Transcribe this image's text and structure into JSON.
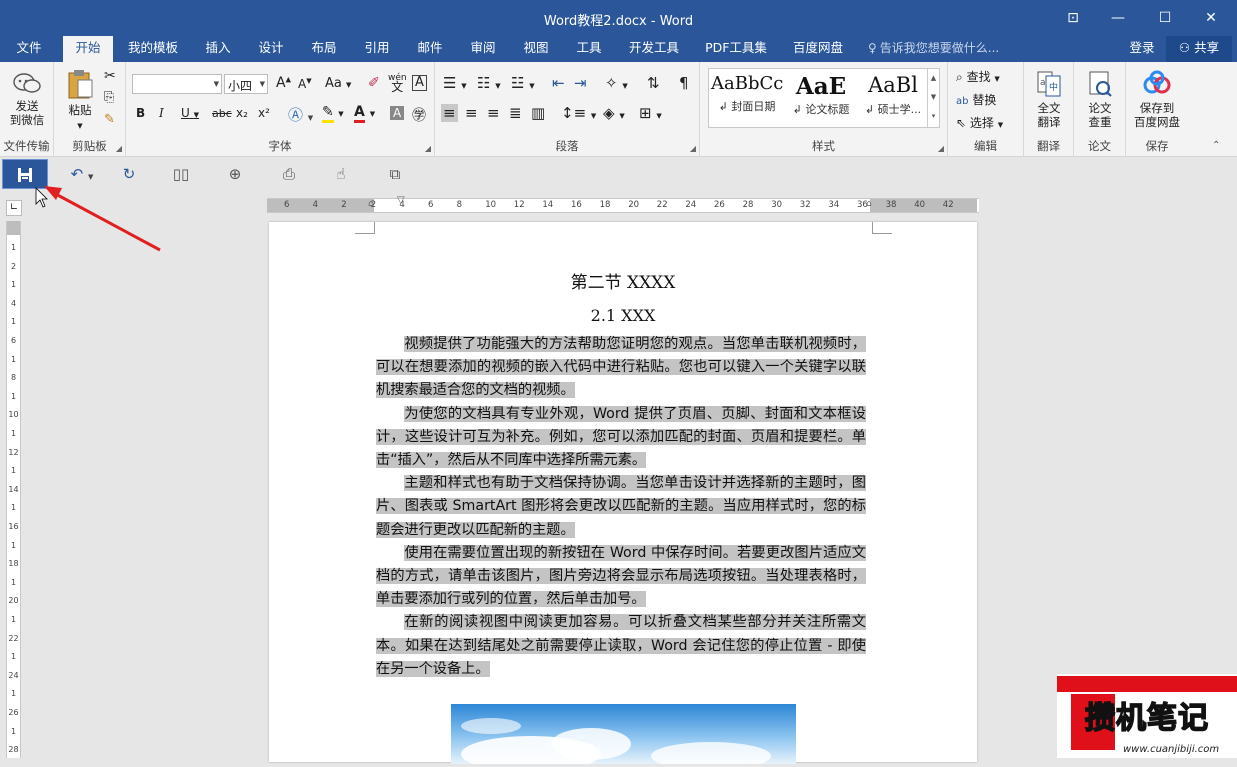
{
  "window": {
    "title": "Word教程2.docx - Word",
    "ribbon_options_glyph": "⊡",
    "minimize_glyph": "—",
    "restore_glyph": "☐",
    "close_glyph": "✕"
  },
  "tabs": [
    {
      "label": "文件"
    },
    {
      "label": "开始"
    },
    {
      "label": "我的模板"
    },
    {
      "label": "插入"
    },
    {
      "label": "设计"
    },
    {
      "label": "布局"
    },
    {
      "label": "引用"
    },
    {
      "label": "邮件"
    },
    {
      "label": "审阅"
    },
    {
      "label": "视图"
    },
    {
      "label": "工具"
    },
    {
      "label": "开发工具"
    },
    {
      "label": "PDF工具集"
    },
    {
      "label": "百度网盘"
    }
  ],
  "tellme": "告诉我您想要做什么...",
  "login": "登录",
  "share": "共享",
  "ribbon": {
    "file_transfer": {
      "send_line1": "发送",
      "send_line2": "到微信",
      "label": "文件传输"
    },
    "clipboard": {
      "paste": "粘贴",
      "label": "剪贴板"
    },
    "font": {
      "font_name": "",
      "font_size": "小四",
      "label": "字体",
      "bold": "B",
      "italic": "I",
      "underline": "U",
      "strike": "abc",
      "sub": "x₂",
      "sup": "x²",
      "grow": "A",
      "shrink": "A",
      "case": "Aa",
      "phonetic": "wén",
      "char_border": "A"
    },
    "paragraph": {
      "label": "段落"
    },
    "styles": {
      "label": "样式",
      "items": [
        {
          "sample": "AaBbCc",
          "name": "↲ 封面日期"
        },
        {
          "sample": "AaE",
          "name": "↲ 论文标题"
        },
        {
          "sample": "AaBl",
          "name": "↲ 硕士学..."
        }
      ]
    },
    "editing": {
      "find": "查找",
      "replace": "替换",
      "select": "选择",
      "label": "编辑"
    },
    "translate": {
      "btn_line1": "全文",
      "btn_line2": "翻译",
      "label": "翻译"
    },
    "thesis": {
      "btn_line1": "论文",
      "btn_line2": "查重",
      "label": "论文"
    },
    "save": {
      "btn_line1": "保存到",
      "btn_line2": "百度网盘",
      "label": "保存"
    }
  },
  "document": {
    "heading1": "第二节 XXXX",
    "heading2": "2.1 XXX",
    "paragraphs": [
      "视频提供了功能强大的方法帮助您证明您的观点。当您单击联机视频时，可以在想要添加的视频的嵌入代码中进行粘贴。您也可以键入一个关键字以联机搜索最适合您的文档的视频。",
      "为使您的文档具有专业外观，Word 提供了页眉、页脚、封面和文本框设计，这些设计可互为补充。例如，您可以添加匹配的封面、页眉和提要栏。单击“插入”，然后从不同库中选择所需元素。",
      "主题和样式也有助于文档保持协调。当您单击设计并选择新的主题时，图片、图表或 SmartArt 图形将会更改以匹配新的主题。当应用样式时，您的标题会进行更改以匹配新的主题。",
      "使用在需要位置出现的新按钮在 Word 中保存时间。若要更改图片适应文档的方式，请单击该图片，图片旁边将会显示布局选项按钮。当处理表格时，单击要添加行或列的位置，然后单击加号。",
      "在新的阅读视图中阅读更加容易。可以折叠文档某些部分并关注所需文本。如果在达到结尾处之前需要停止读取，Word 会记住您的停止位置 - 即使在另一个设备上。"
    ]
  },
  "hruler_ticks": [
    "6",
    "4",
    "2",
    "2",
    "4",
    "6",
    "8",
    "10",
    "12",
    "14",
    "16",
    "18",
    "20",
    "22",
    "24",
    "26",
    "28",
    "30",
    "32",
    "34",
    "36",
    "38",
    "40",
    "42"
  ],
  "vruler_ticks": [
    "1",
    "2",
    "1",
    "4",
    "1",
    "6",
    "1",
    "8",
    "1",
    "10",
    "1",
    "12",
    "1",
    "14",
    "1",
    "16",
    "1",
    "18",
    "1",
    "20",
    "1",
    "22",
    "1",
    "24",
    "1",
    "26",
    "1",
    "28"
  ],
  "watermark": {
    "text": "攒机笔记",
    "url": "www.cuanjibiji.com"
  },
  "colors": {
    "brand": "#2b579a",
    "arrow": "#e02020",
    "highlight": "#c4c4c4"
  }
}
